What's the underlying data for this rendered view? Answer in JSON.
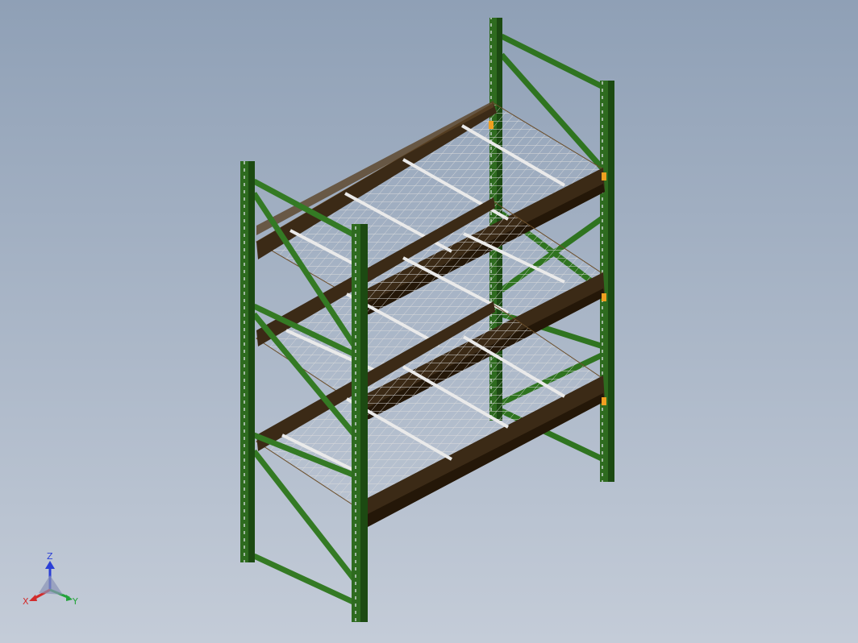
{
  "viewport": {
    "background_top": "#8fa0b6",
    "background_bottom": "#c4ccd8"
  },
  "model": {
    "name": "",
    "colors": {
      "upright": "#2e6b1f",
      "upright_dark": "#1c4a12",
      "brace": "#347a24",
      "beam": "#3b2a16",
      "beam_dark": "#241708",
      "wire_deck": "#d8d8dc",
      "wire_edge": "#6b4e2a",
      "support_bar": "#eaeaea",
      "connector": "#f0a020"
    }
  },
  "triad": {
    "x_label": "X",
    "y_label": "Y",
    "z_label": "Z",
    "x_color": "#d22b2b",
    "y_color": "#22a33a",
    "z_color": "#2b3fd6"
  }
}
